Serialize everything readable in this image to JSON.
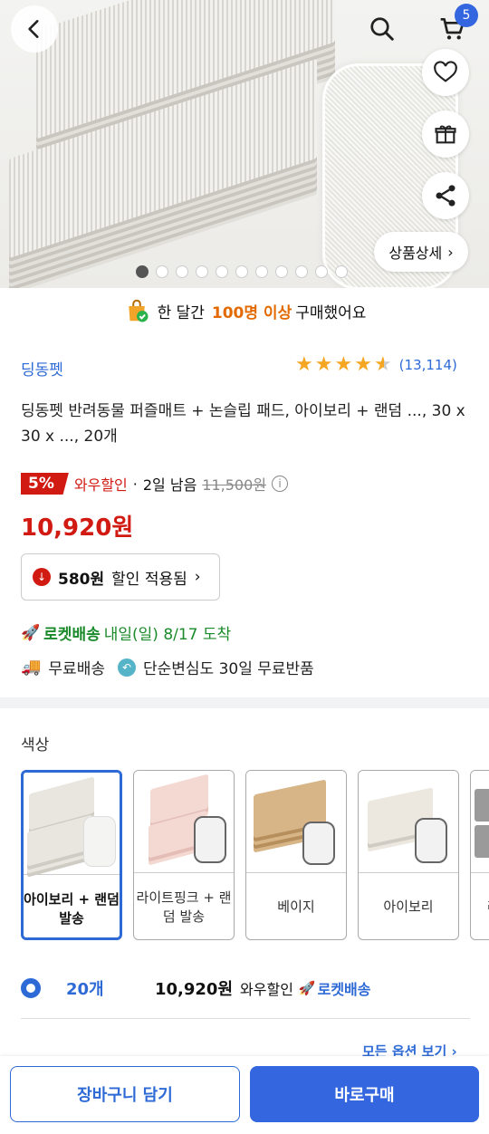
{
  "header": {
    "cart_count": "5"
  },
  "hero": {
    "detail_label": "상품상세",
    "image_count": 11,
    "active_index": 0
  },
  "buyers": {
    "prefix": "한 달간",
    "highlight": "100명 이상",
    "suffix": "구매했어요"
  },
  "product": {
    "brand": "딩동펫",
    "rating_value": 4.5,
    "rating_count": "(13,114)",
    "title": "딩동펫 반려동물 퍼즐매트 + 논슬립 패드, 아이보리 + 랜덤 ..., 30 x 30 x ..., 20개",
    "discount_pct": "5%",
    "wow_label": "와우할인",
    "days_left": "2일 남음",
    "original_price": "11,500원",
    "price": "10,920원",
    "coupon_amount": "580원",
    "coupon_text": "할인 적용됨"
  },
  "shipping": {
    "rocket_label": "로켓배송",
    "eta": "내일(일) 8/17 도착",
    "free_shipping": "무료배송",
    "free_return": "단순변심도 30일 무료반품"
  },
  "options": {
    "color_label": "색상",
    "swatches": [
      {
        "label": "아이보리 + 랜덤 발송",
        "selected": true
      },
      {
        "label": "라이트핑크 + 랜덤 발송",
        "selected": false
      },
      {
        "label": "베이지",
        "selected": false
      },
      {
        "label": "아이보리",
        "selected": false
      },
      {
        "label": "라이트그레이",
        "selected": false
      }
    ],
    "quantity": "20개",
    "quantity_price": "10,920원",
    "quantity_wow": "와우할인",
    "quantity_rocket": "로켓배송",
    "all_options": "모든 옵션 보기 ›"
  },
  "actions": {
    "cart": "장바구니 담기",
    "buy": "바로구매"
  },
  "colors": {
    "accent": "#3466e0",
    "sale": "#d11a12",
    "rocket": "#1a8a2a",
    "star": "#f5a623"
  },
  "icons": [
    "back-icon",
    "search-icon",
    "cart-icon",
    "heart-icon",
    "gift-icon",
    "share-icon",
    "shopping-bag-icon",
    "info-icon",
    "down-arrow-icon",
    "rocket-icon",
    "truck-icon",
    "return-icon"
  ]
}
